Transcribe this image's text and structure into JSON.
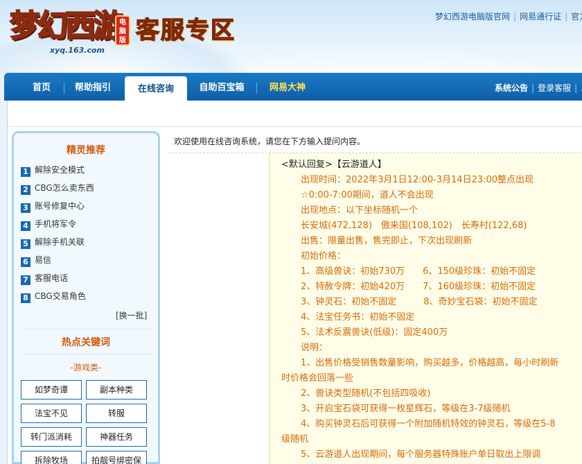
{
  "header": {
    "logo_text": "梦幻西游",
    "logo_badge": "电脑版",
    "logo_url": "xyq.163.com",
    "section_title": "客服专区",
    "top_links": [
      "梦幻西游电脑版官网",
      "网易通行证",
      "官方"
    ]
  },
  "nav": {
    "items": [
      "首页",
      "帮助指引",
      "在线咨询",
      "自助百宝箱",
      "网易大神"
    ],
    "active_index": 2,
    "right_links": [
      "系统公告",
      "登录客服",
      "..."
    ]
  },
  "sidebar": {
    "recommend_title": "精灵推荐",
    "recommend_items": [
      {
        "num": "1",
        "label": "解除安全模式"
      },
      {
        "num": "2",
        "label": "CBG怎么卖东西"
      },
      {
        "num": "3",
        "label": "账号修复中心"
      },
      {
        "num": "4",
        "label": "手机将军令"
      },
      {
        "num": "5",
        "label": "解除手机关联"
      },
      {
        "num": "6",
        "label": "易信"
      },
      {
        "num": "7",
        "label": "客服电话"
      },
      {
        "num": "8",
        "label": "CBG交易角色"
      }
    ],
    "refresh_label": "[换一批]",
    "keywords_title": "热点关键词",
    "keywords_category": "-游戏类-",
    "keywords": [
      "如梦奇谭",
      "副本种类",
      "法宝不见",
      "转服",
      "转门派消耗",
      "神器任务",
      "拆除牧场",
      "拍靓号绑密保"
    ]
  },
  "main": {
    "welcome": "欢迎使用在线咨询系统，请您在下方输入提问内容。",
    "reply_head": "<默认回复>【云游道人】",
    "lines": [
      "出现时间：2022年3月1日12:00-3月14日23:00整点出现",
      "☆0:00-7:00期间，道人不会出现",
      "出现地点：以下坐标随机一个",
      "长安城(472,128)　傲来国(108,102)　长寿村(122,68)",
      "出售：限量出售，售完即止，下次出现刷新",
      "初始价格：",
      "1、高级兽诀：初始730万　　6、150级珍珠：初始不固定",
      "2、特赦令牌：初始420万　　7、160级珍珠：初始不固定",
      "3、钟灵石：初始不固定　　　8、奇妙宝石袋：初始不固定",
      "4、法宝任务书：初始不固定",
      "5、法术反震兽诀(低级)：固定400万",
      "说明：",
      "1、出售价格受销售数量影响，购买越多，价格越高，每小时刷新时价格会回落一些",
      "2、兽诀类型随机(不包括四吸收)",
      "3、开启宝石袋可获得一枚星辉石，等级在3-7级随机",
      "4、购买钟灵石后可获得一个附加随机特效的钟灵石，等级在5-8级随机",
      "5、云游道人出现期间，每个服务器特殊账户单日取出上限调"
    ]
  },
  "colors": {
    "nav_blue": "#1b79c4",
    "accent_orange": "#d4590d",
    "reply_text": "#d66a08",
    "reply_bg": "#fffde8"
  }
}
